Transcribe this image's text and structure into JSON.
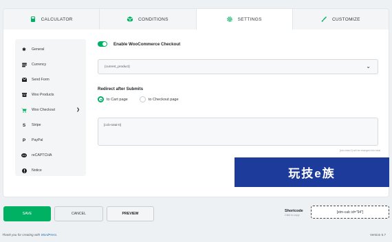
{
  "tabs": [
    {
      "label": "CALCULATOR",
      "icon": "calculator-icon"
    },
    {
      "label": "CONDITIONS",
      "icon": "cube-icon"
    },
    {
      "label": "SETTINGS",
      "icon": "gear-icon",
      "active": true
    },
    {
      "label": "CUSTOMIZE",
      "icon": "brush-icon"
    }
  ],
  "sidebar": {
    "items": [
      {
        "label": "General",
        "icon": "gear-icon"
      },
      {
        "label": "Currency",
        "icon": "coins-icon"
      },
      {
        "label": "Send Form",
        "icon": "send-icon"
      },
      {
        "label": "Woo Products",
        "icon": "box-icon"
      },
      {
        "label": "Woo Checkout",
        "icon": "cart-icon",
        "active": true
      },
      {
        "label": "Stripe",
        "icon": "stripe-icon"
      },
      {
        "label": "PayPal",
        "icon": "paypal-icon"
      },
      {
        "label": "reCAPTCHA",
        "icon": "recaptcha-icon"
      },
      {
        "label": "Notice",
        "icon": "info-icon"
      }
    ]
  },
  "settings": {
    "toggle_label": "Enable WooCommerce Checkout",
    "toggle_on": true,
    "product_select_value": "{current_product}",
    "redirect_title": "Redirect after Submits",
    "radio_cart": "to Cart page",
    "radio_checkout": "to Checkout page",
    "selected_redirect": "cart",
    "textarea_value": "[ccb-total-0]",
    "hint": "[ccb-total-0] will be changed into total"
  },
  "watermark": "玩技e族",
  "footer": {
    "save": "SAVE",
    "cancel": "CANCEL",
    "preview": "PREVIEW",
    "shortcode_title": "Shortcode",
    "shortcode_sub": "Click to copy",
    "shortcode_value": "[stm-calc id=\"94\"]",
    "thanks_prefix": "Thank you for creating with ",
    "thanks_link": "WordPress",
    "thanks_suffix": ".",
    "version": "Version 5.7"
  },
  "colors": {
    "accent": "#00b163",
    "watermark_bg": "#1d3b9a"
  }
}
